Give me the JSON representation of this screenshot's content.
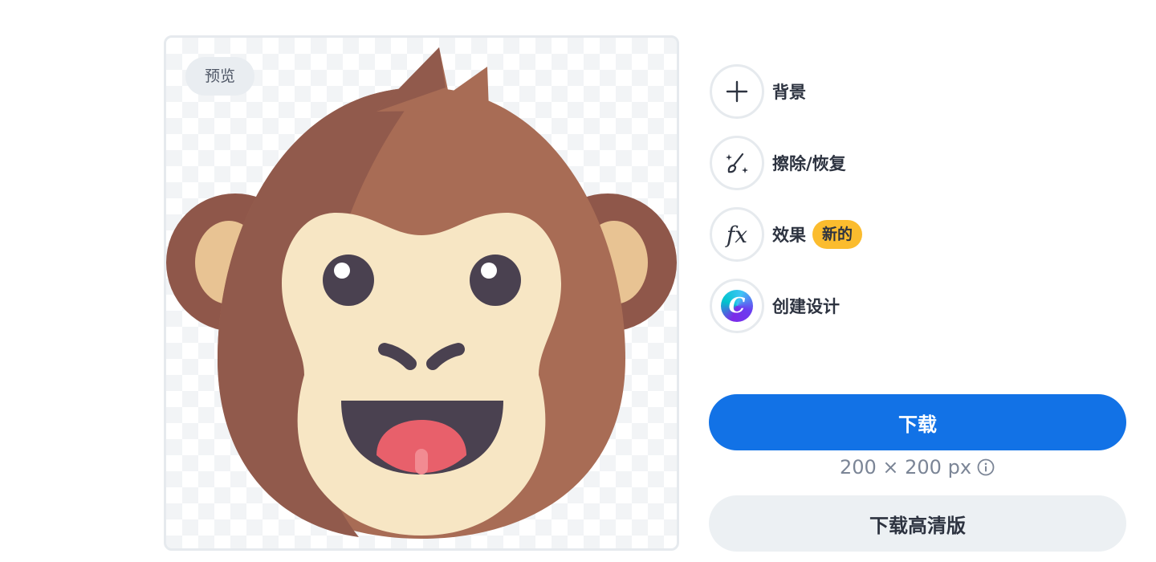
{
  "preview": {
    "badge": "预览"
  },
  "tools": {
    "background": "背景",
    "erase_restore": "擦除/恢复",
    "effects": "效果",
    "effects_badge": "新的",
    "create_design": "创建设计",
    "canva_logo_letter": "C"
  },
  "actions": {
    "download": "下载",
    "size": "200 × 200 px",
    "download_hd": "下载高清版"
  },
  "colors": {
    "primary": "#1272e6",
    "new_badge": "#fbbc2e",
    "monkey_fur": "#a86c55",
    "monkey_face": "#f7e6c4"
  },
  "icons": [
    "plus-icon",
    "magic-brush-icon",
    "fx-icon",
    "canva-logo",
    "info-icon"
  ]
}
